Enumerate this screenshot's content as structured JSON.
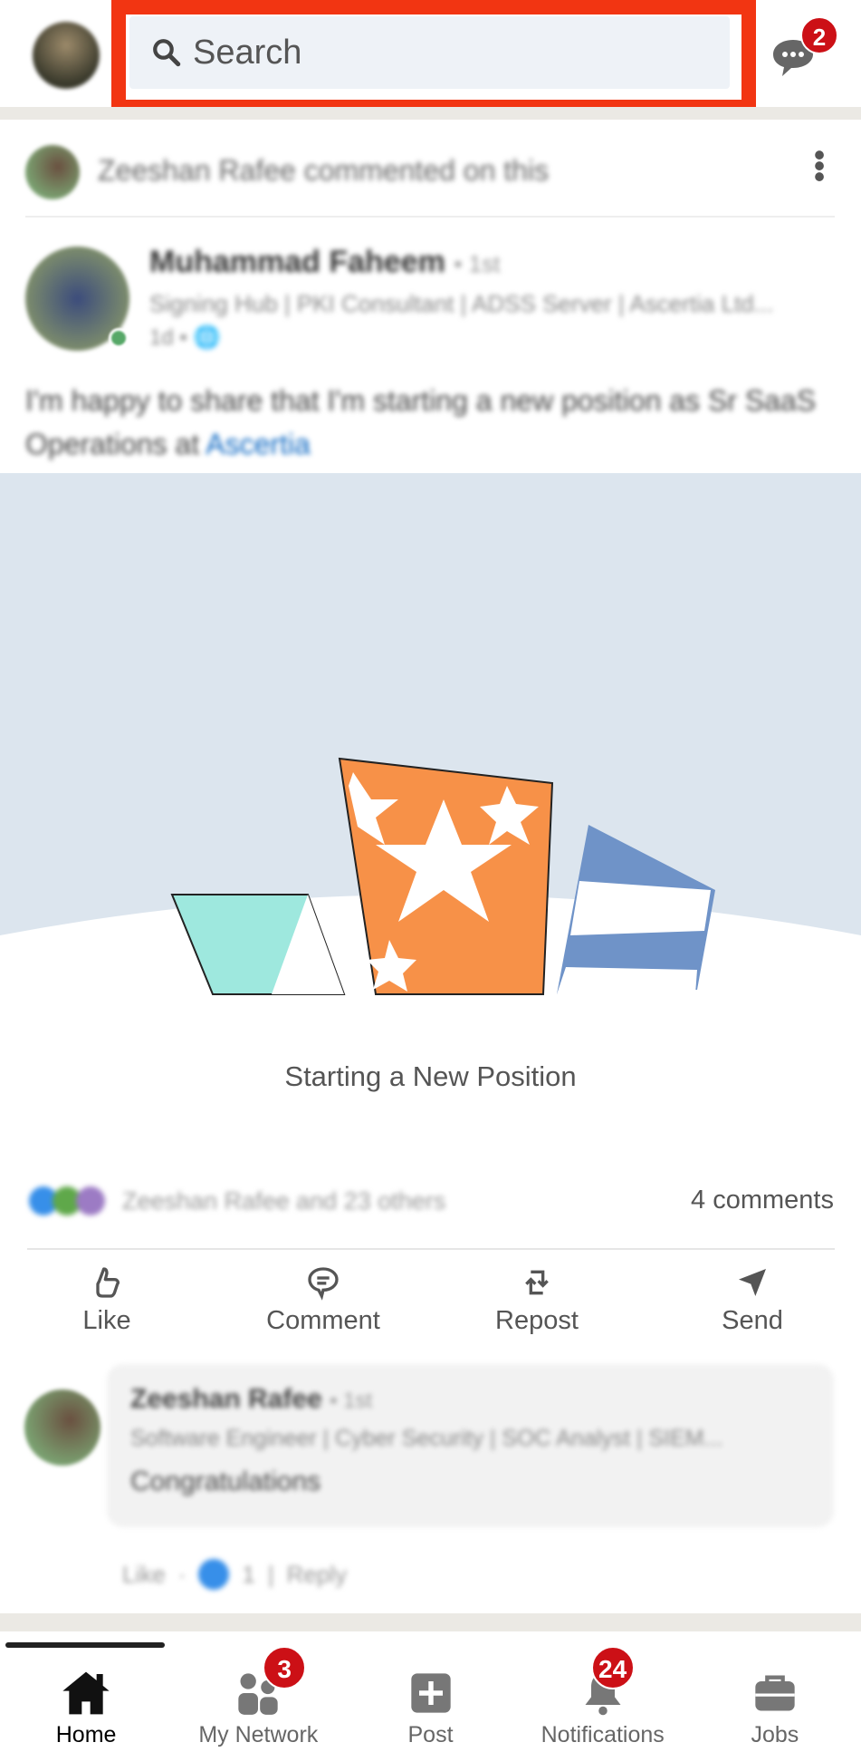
{
  "header": {
    "search_placeholder": "Search",
    "messages_badge": "2"
  },
  "feed": {
    "context": "Zeeshan Rafee commented on this",
    "author": {
      "name": "Muhammad Faheem",
      "degree": "• 1st",
      "headline": "Signing Hub | PKI Consultant | ADSS Server | Ascertia Ltd...",
      "time": "1d •"
    },
    "post_text": "I'm happy to share that I'm starting a new position as Sr SaaS Operations at ",
    "post_link": "Ascertia",
    "art_title": "Starting a New Position",
    "reactions_text": "Zeeshan Rafee and 23 others",
    "comments_count": "4 comments",
    "actions": [
      {
        "label": "Like",
        "icon": "thumbs-up-icon"
      },
      {
        "label": "Comment",
        "icon": "comment-icon"
      },
      {
        "label": "Repost",
        "icon": "repost-icon"
      },
      {
        "label": "Send",
        "icon": "send-icon"
      }
    ],
    "comment": {
      "name": "Zeeshan Rafee",
      "degree": "• 1st",
      "headline": "Software Engineer | Cyber Security | SOC Analyst | SIEM...",
      "text": "Congratulations",
      "like": "Like",
      "like_count": "1",
      "reply": "Reply"
    }
  },
  "nav": [
    {
      "label": "Home",
      "icon": "home-icon",
      "active": true
    },
    {
      "label": "My Network",
      "icon": "network-icon",
      "badge": "3"
    },
    {
      "label": "Post",
      "icon": "post-icon"
    },
    {
      "label": "Notifications",
      "icon": "bell-icon",
      "badge": "24"
    },
    {
      "label": "Jobs",
      "icon": "briefcase-icon"
    }
  ],
  "colors": {
    "highlight": "#f23512",
    "badge": "#cc1016",
    "link": "#0a66c2",
    "art_bg": "#dce5ee"
  }
}
